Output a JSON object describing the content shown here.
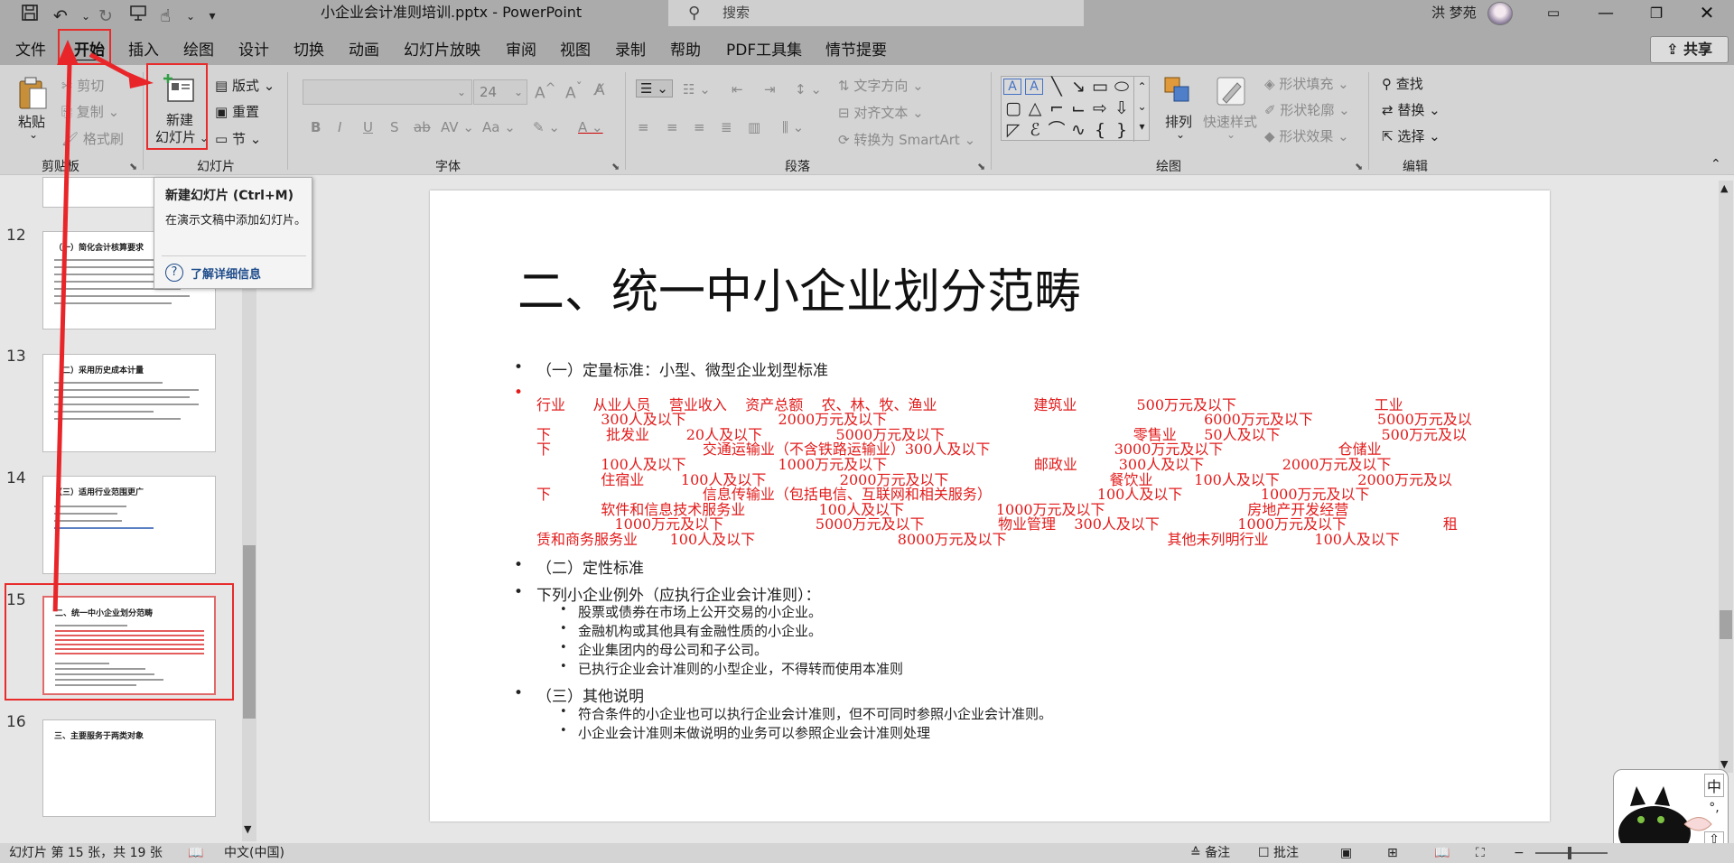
{
  "titlebar": {
    "doc_title": "小企业会计准则培训.pptx  -  PowerPoint",
    "search_placeholder": "搜索",
    "user_name": "洪 梦苑",
    "icons": [
      "save-icon",
      "undo-icon",
      "redo-icon",
      "present-icon",
      "touch-mode-icon",
      "customize-icon"
    ]
  },
  "menu": {
    "tabs": [
      "文件",
      "开始",
      "插入",
      "绘图",
      "设计",
      "切换",
      "动画",
      "幻灯片放映",
      "审阅",
      "视图",
      "录制",
      "帮助",
      "PDF工具集",
      "情节提要"
    ],
    "active_tab": "开始",
    "share_label": "共享"
  },
  "ribbon": {
    "clipboard": {
      "label": "剪贴板",
      "paste": "粘贴",
      "cut": "剪切",
      "copy": "复制",
      "format_painter": "格式刷"
    },
    "slides": {
      "label": "幻灯片",
      "new_slide_line1": "新建",
      "new_slide_line2": "幻灯片",
      "layout": "版式",
      "reset": "重置",
      "section": "节"
    },
    "font": {
      "label": "字体",
      "font_size": "24"
    },
    "paragraph": {
      "label": "段落",
      "text_direction": "文字方向",
      "align_text": "对齐文本",
      "smartart": "转换为 SmartArt"
    },
    "drawing": {
      "label": "绘图",
      "arrange": "排列",
      "quick_styles": "快速样式",
      "shape_fill": "形状填充",
      "shape_outline": "形状轮廓",
      "shape_effects": "形状效果"
    },
    "editing": {
      "label": "编辑",
      "find": "查找",
      "replace": "替换",
      "select": "选择"
    }
  },
  "tooltip": {
    "title": "新建幻灯片 (Ctrl+M)",
    "body": "在演示文稿中添加幻灯片。",
    "link": "了解详细信息"
  },
  "thumbnails": [
    {
      "num": "12",
      "title": "（一）简化会计核算要求"
    },
    {
      "num": "13",
      "title": "（二）采用历史成本计量"
    },
    {
      "num": "14",
      "title": "（三）适用行业范围更广"
    },
    {
      "num": "15",
      "title": "二、统一中小企业划分范畴"
    },
    {
      "num": "16",
      "title": "三、主要服务于两类对象"
    }
  ],
  "slide": {
    "title": "二、统一中小企业划分范畴",
    "b1": "（一）定量标准：小型、微型企业划型标准",
    "red_lines": [
      "行业      从业人员    营业收入    资产总额    农、林、牧、渔业                     建筑业             500万元及以下                              工业",
      "              300人及以下                    2000万元及以下                                                                     6000万元及以下              5000万元及以",
      "下            批发业        20人及以下                5000万元及以下                                         零售业      50人及以下                      500万元及以",
      "下                                 交通运输业（不含铁路运输业）300人及以下                           3000万元及以下                         仓储业",
      "              100人及以下                    1000万元及以下                                邮政业         300人及以下                 2000万元及以下",
      "              住宿业        100人及以下                2000万元及以下                                   餐饮业         100人及以下                 2000万元及以",
      "下                                 信息传输业（包括电信、互联网和相关服务）                       100人及以下                 1000万元及以下",
      "              软件和信息技术服务业                100人及以下                    1000万元及以下                               房地产开发经营",
      "                 1000万元及以下                    5000万元及以下                物业管理    300人及以下                 1000万元及以下                     租",
      "赁和商务服务业       100人及以下                               8000万元及以下                                   其他未列明行业          100人及以下"
    ],
    "b2": "（二）定性标准",
    "b3": "下列小企业例外（应执行企业会计准则）：",
    "sub3": [
      "股票或债券在市场上公开交易的小企业。",
      "金融机构或其他具有金融性质的小企业。",
      "企业集团内的母公司和子公司。",
      "已执行企业会计准则的小型企业，不得转而使用本准则"
    ],
    "b4": "（三）其他说明",
    "sub4": [
      "符合条件的小企业也可以执行企业会计准则，但不可同时参照小企业会计准则。",
      "小企业会计准则未做说明的业务可以参照企业会计准则处理"
    ]
  },
  "status": {
    "slide_info": "幻灯片 第 15 张，共 19 张",
    "language": "中文(中国)",
    "notes": "备注",
    "comments": "批注"
  },
  "widget": {
    "ime1": "中",
    "ime2": "°,",
    "ime3": "⇧"
  }
}
